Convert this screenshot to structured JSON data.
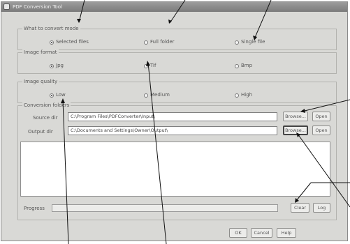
{
  "window": {
    "title": "PDF Conversion Tool"
  },
  "modes": {
    "legend": "What to convert mode",
    "options": [
      {
        "label": "Selected files",
        "selected": true
      },
      {
        "label": "Full folder",
        "selected": false
      },
      {
        "label": "Single file",
        "selected": false
      }
    ]
  },
  "image_format": {
    "legend": "Image format",
    "options": [
      {
        "label": "Jpg",
        "selected": true
      },
      {
        "label": "Tif",
        "selected": false
      },
      {
        "label": "Bmp",
        "selected": false
      }
    ]
  },
  "quality": {
    "legend": "Image quality",
    "options": [
      {
        "label": "Low",
        "selected": true
      },
      {
        "label": "Medium",
        "selected": false
      },
      {
        "label": "High",
        "selected": false
      }
    ]
  },
  "folders": {
    "legend": "Conversion folders",
    "source_label": "Source dir",
    "source_value": "C:\\Program Files\\PDFConverter\\Input\\",
    "source_browse": "Browse...",
    "source_open": "Open",
    "output_label": "Output dir",
    "output_value": "C:\\Documents and Settings\\Owner\\Output\\",
    "output_browse": "Browse...",
    "output_open": "Open"
  },
  "progress": {
    "label": "Progress",
    "value": 0
  },
  "buttons": {
    "clear": "Clear",
    "log": "Log",
    "ok": "OK",
    "cancel": "Cancel",
    "help": "Help"
  }
}
